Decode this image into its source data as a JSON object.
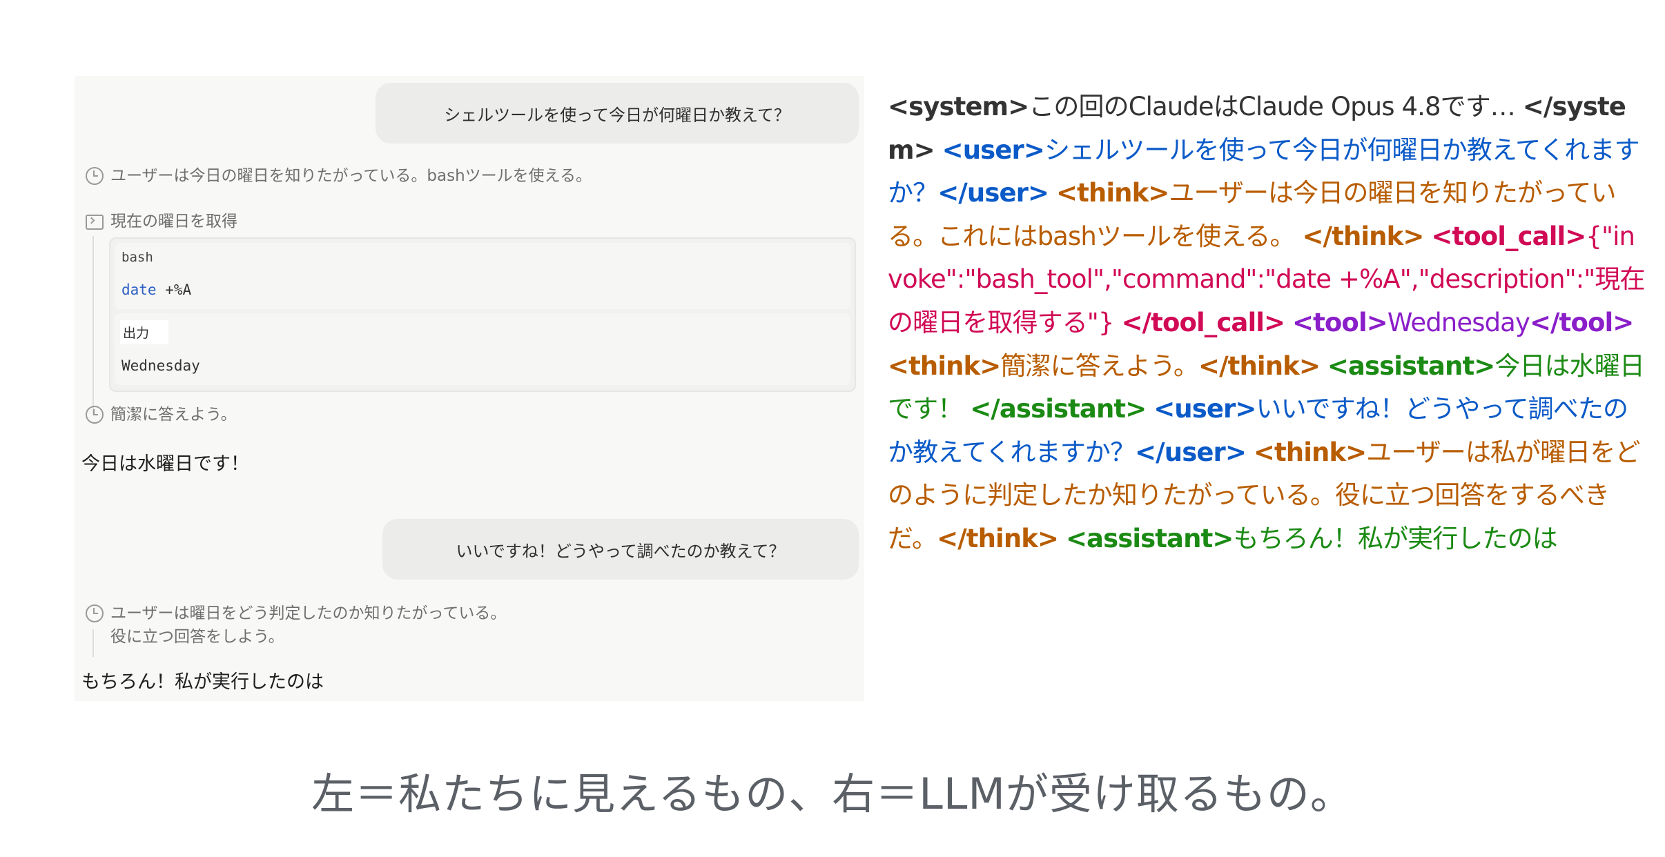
{
  "chat": {
    "user_message_1": "シェルツールを使って今日が何曜日か教えて？",
    "thought_1": "ユーザーは今日の曜日を知りたがっている。bashツールを使える。",
    "tool_title": "現在の曜日を取得",
    "code_lang": "bash",
    "command_keyword": "date",
    "command_args": " +%A",
    "output_label": "出力",
    "output_value": "Wednesday",
    "thought_2": "簡潔に答えよう。",
    "answer_1": "今日は水曜日です！",
    "user_message_2": "いいですね！どうやって調べたのか教えて？",
    "thought_3_line1": "ユーザーは曜日をどう判定したのか知りたがっている。",
    "thought_3_line2": "役に立つ回答をしよう。",
    "answer_2": "もちろん！私が実行したのは"
  },
  "raw": {
    "system_open": "<system>",
    "system_text": "この回のClaudeはClaude Opus 4.8です…",
    "system_close": "</system>",
    "user1_open": "<user>",
    "user1_text": "シェルツールを使って今日が何曜日か教えてくれますか？",
    "user1_close": "</user>",
    "think1_open": "<think>",
    "think1_text": "ユーザーは今日の曜日を知りたがっている。これにはbashツールを使える。",
    "think1_close": "</think>",
    "call_open": "<tool_call>",
    "call_text": "{\"invoke\":\"bash_tool\",\"command\":\"date +%A\",\"description\":\"現在の曜日を取得する\"}",
    "call_close": "</tool_call>",
    "tool_open": "<tool>",
    "tool_text": "Wednesday",
    "tool_close": "</tool>",
    "think2_open": "<think>",
    "think2_text": "簡潔に答えよう。",
    "think2_close": "</think>",
    "asst1_open": "<assistant>",
    "asst1_text": "今日は水曜日です！",
    "asst1_close": "</assistant>",
    "user2_open": "<user>",
    "user2_text": "いいですね！どうやって調べたのか教えてくれますか？",
    "user2_close": "</user>",
    "think3_open": "<think>",
    "think3_text": "ユーザーは私が曜日をどのように判定したか知りたがっている。役に立つ回答をするべきだ。",
    "think3_close": "</think>",
    "asst2_open": "<assistant>",
    "asst2_text": "もちろん！私が実行したのは"
  },
  "caption": "左＝私たちに見えるもの、右＝LLMが受け取るもの。",
  "colors": {
    "system": "#333333",
    "user": "#0b5ac8",
    "think": "#b85c00",
    "tool_call": "#d10a55",
    "tool": "#8a1ec9",
    "assistant": "#1b8a14"
  }
}
